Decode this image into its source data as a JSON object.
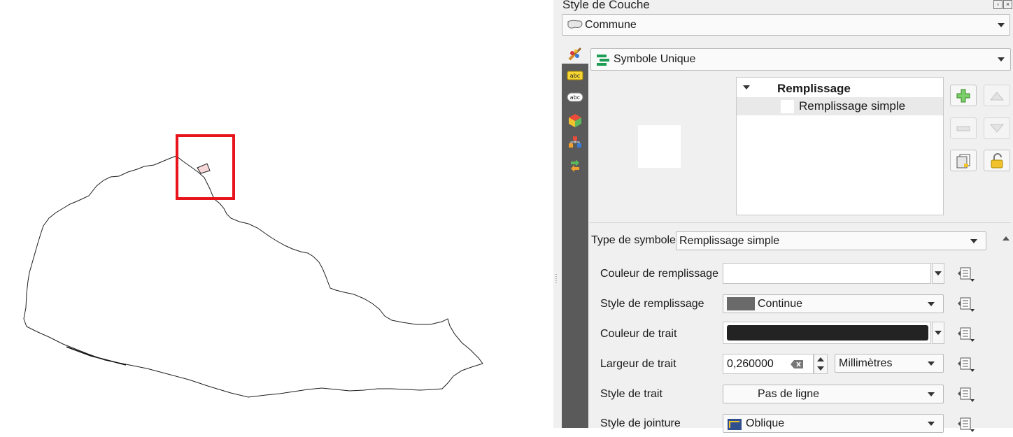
{
  "panel": {
    "title": "Style de Couche",
    "layer_combo": "Commune",
    "renderer_combo": "Symbole Unique"
  },
  "symbol_tree": {
    "root_label": "Remplissage",
    "child_label": "Remplissage simple"
  },
  "properties": {
    "symbol_type_label": "Type de symbole",
    "symbol_type_value": "Remplissage simple",
    "fill_color_label": "Couleur de remplissage",
    "fill_color_value": "#ffffff",
    "fill_style_label": "Style de remplissage",
    "fill_style_value": "Continue",
    "stroke_color_label": "Couleur de trait",
    "stroke_color_value": "#232323",
    "stroke_width_label": "Largeur de trait",
    "stroke_width_value": "0,260000",
    "stroke_width_unit": "Millimètres",
    "stroke_style_label": "Style de trait",
    "stroke_style_value": "Pas de ligne",
    "join_style_label": "Style de jointure",
    "join_style_value": "Oblique"
  },
  "colors": {
    "highlight_box": "#e8141b",
    "selected_feature_fill": "#f6d6d6",
    "sidebar": "#5a5a5a"
  }
}
